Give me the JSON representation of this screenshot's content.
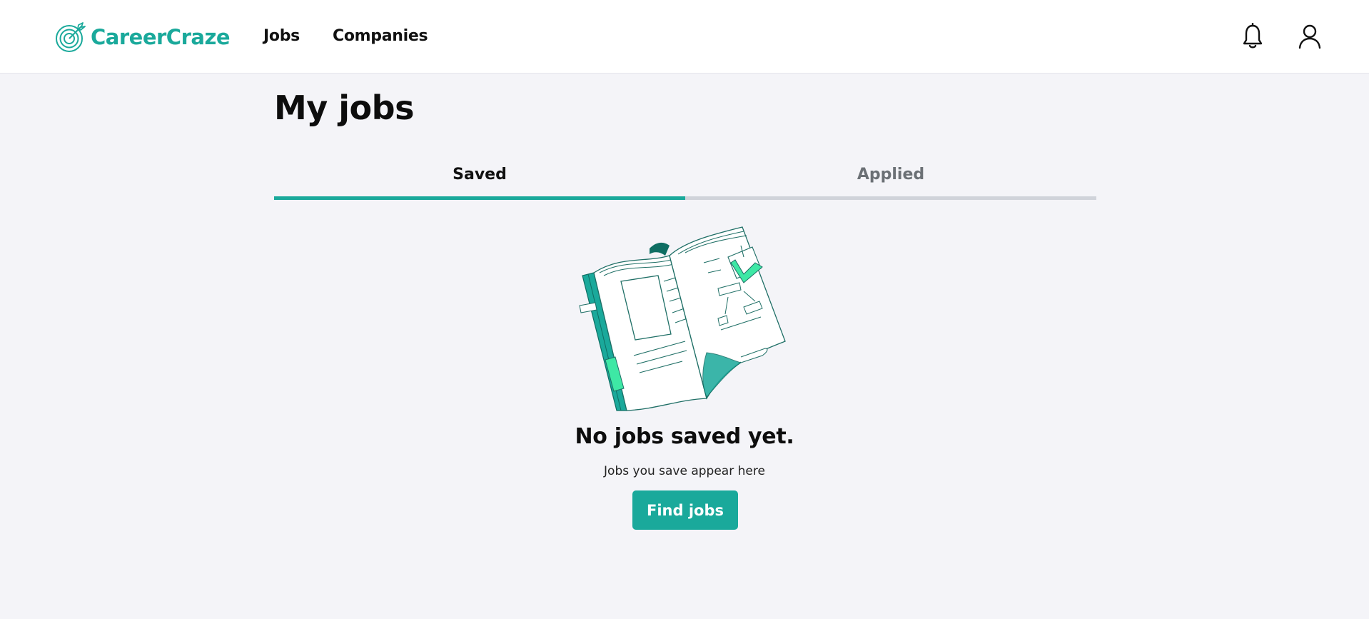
{
  "header": {
    "logo_text": "CareerCraze",
    "logo_icon": "target-icon",
    "nav": [
      {
        "label": "Jobs"
      },
      {
        "label": "Companies"
      }
    ],
    "icons": [
      "bell-icon",
      "user-icon"
    ]
  },
  "main": {
    "title": "My jobs",
    "tabs": [
      {
        "label": "Saved",
        "active": true
      },
      {
        "label": "Applied",
        "active": false
      }
    ],
    "empty_state": {
      "illustration": "open-book-illustration",
      "title": "No jobs saved yet.",
      "subtitle": "Jobs you save appear here",
      "button_label": "Find jobs"
    }
  },
  "colors": {
    "accent": "#1aa99b",
    "accent_light": "#3ee8a5",
    "background": "#f4f4f8",
    "tab_inactive_bar": "#d0d3da"
  }
}
